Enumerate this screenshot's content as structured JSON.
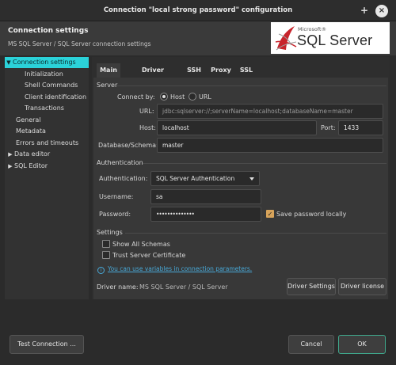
{
  "window": {
    "title": "Connection \"local strong password\" configuration"
  },
  "header": {
    "title": "Connection settings",
    "subtitle": "MS SQL Server / SQL Server connection settings",
    "logo": {
      "microsoft": "Microsoft®",
      "product": "SQL Server"
    }
  },
  "sidebar": {
    "items": [
      {
        "label": "Connection settings",
        "expanded": true,
        "selected": true
      },
      {
        "label": "Initialization"
      },
      {
        "label": "Shell Commands"
      },
      {
        "label": "Client identification"
      },
      {
        "label": "Transactions"
      },
      {
        "label": "General"
      },
      {
        "label": "Metadata"
      },
      {
        "label": "Errors and timeouts"
      },
      {
        "label": "Data editor",
        "collapsed": true
      },
      {
        "label": "SQL Editor",
        "collapsed": true
      }
    ]
  },
  "tabs": [
    {
      "label": "Main",
      "active": true
    },
    {
      "label": "Driver properties"
    },
    {
      "label": "SSH"
    },
    {
      "label": "Proxy"
    },
    {
      "label": "SSL"
    }
  ],
  "server": {
    "group_title": "Server",
    "connect_by_label": "Connect by:",
    "option_host": "Host",
    "option_url": "URL",
    "selected": "Host",
    "url_label": "URL:",
    "url_value": "jdbc:sqlserver://;serverName=localhost;databaseName=master",
    "host_label": "Host:",
    "host_value": "localhost",
    "port_label": "Port:",
    "port_value": "1433",
    "db_label": "Database/Schema:",
    "db_value": "master"
  },
  "auth": {
    "group_title": "Authentication",
    "auth_label": "Authentication:",
    "auth_value": "SQL Server Authentication",
    "username_label": "Username:",
    "username_value": "sa",
    "password_label": "Password:",
    "password_value": "••••••••••••••",
    "save_password_label": "Save password locally",
    "save_password_checked": true
  },
  "settings": {
    "group_title": "Settings",
    "show_all_schemas": "Show All Schemas",
    "trust_server_cert": "Trust Server Certificate"
  },
  "info_link": "You can use variables in connection parameters.",
  "driver": {
    "name_label": "Driver name:",
    "name_value": "MS SQL Server / SQL Server",
    "settings_button": "Driver Settings",
    "license_button": "Driver license"
  },
  "footer": {
    "test_button": "Test Connection ...",
    "cancel_button": "Cancel",
    "ok_button": "OK"
  },
  "colors": {
    "selection": "#2bd2d9",
    "link": "#48a9d8",
    "checkbox": "#d7a35a",
    "ok_border": "#3fa88c"
  }
}
